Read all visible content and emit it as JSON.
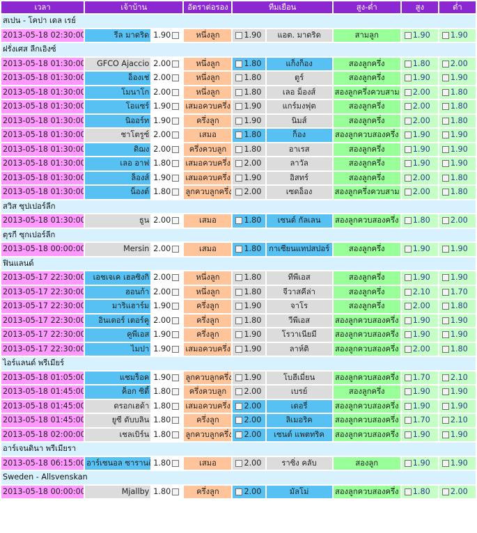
{
  "headers": [
    "เวลา",
    "เจ้าบ้าน",
    "อัตราต่อรอง",
    "ทีมเยือน",
    "สูง-ต่ำ",
    "สูง",
    "ต่ำ"
  ],
  "colors": {
    "header": "#8c28d2",
    "time": "#ff99ff",
    "favorite": "#56c1f2",
    "underdog": "#dcdcdc",
    "handicap": "#ffc499",
    "over_under": "#99ff99",
    "ou_odds": "#c5ffc5",
    "league": "#d7f1ff"
  },
  "leagues": [
    {
      "name": "สเปน - โคปา เดล เรย์",
      "matches": [
        {
          "time": "2013-05-18 02:30:00",
          "home": "รีล มาดริด",
          "home_odds": "1.90",
          "handicap": "หนึ่งลูก",
          "away_odds": "1.90",
          "away": "แอต. มาดริด",
          "ou": "สามลูก",
          "over": "1.90",
          "under": "1.90",
          "home_fav": true
        }
      ]
    },
    {
      "name": "ฝรั่งเศส ลีกเอิงซ์",
      "matches": [
        {
          "time": "2013-05-18 01:30:00",
          "home": "GFCO Ajaccio",
          "home_odds": "2.00",
          "handicap": "หนึ่งลูก",
          "away_odds": "1.80",
          "away": "แก็งก็อง",
          "ou": "สองลูกครึ่ง",
          "over": "1.80",
          "under": "2.00",
          "home_fav": false
        },
        {
          "time": "2013-05-18 01:30:00",
          "home": "อ็องเช่",
          "home_odds": "2.00",
          "handicap": "หนึ่งลูก",
          "away_odds": "1.80",
          "away": "ตูร์",
          "ou": "สองลูกครึ่ง",
          "over": "1.90",
          "under": "1.90",
          "home_fav": true
        },
        {
          "time": "2013-05-18 01:30:00",
          "home": "โมนาโก",
          "home_odds": "2.00",
          "handicap": "หนึ่งลูก",
          "away_odds": "1.80",
          "away": "เลอ ม็องส์",
          "ou": "สองลูกครึ่งควบสาม",
          "over": "2.00",
          "under": "1.80",
          "home_fav": true
        },
        {
          "time": "2013-05-18 01:30:00",
          "home": "โอแซร์",
          "home_odds": "1.90",
          "handicap": "เสมอควบครึ่ง",
          "away_odds": "1.90",
          "away": "แกร์มงฟุต",
          "ou": "สองลูกครึ่ง",
          "over": "2.00",
          "under": "1.80",
          "home_fav": true
        },
        {
          "time": "2013-05-18 01:30:00",
          "home": "นิออร์ท",
          "home_odds": "1.90",
          "handicap": "ครึ่งลูก",
          "away_odds": "1.90",
          "away": "นิมส์",
          "ou": "สองลูกครึ่ง",
          "over": "2.00",
          "under": "1.80",
          "home_fav": true
        },
        {
          "time": "2013-05-18 01:30:00",
          "home": "ชาโตรูซ์",
          "home_odds": "2.00",
          "handicap": "เสมอ",
          "away_odds": "1.80",
          "away": "ก็อง",
          "ou": "สองลูกควบสองครึ่ง",
          "over": "1.90",
          "under": "1.90",
          "home_fav": false
        },
        {
          "time": "2013-05-18 01:30:00",
          "home": "ดิฌง",
          "home_odds": "2.00",
          "handicap": "ครึ่งควบลูก",
          "away_odds": "1.80",
          "away": "อาเรส",
          "ou": "สองลูกครึ่ง",
          "over": "1.90",
          "under": "1.90",
          "home_fav": true
        },
        {
          "time": "2013-05-18 01:30:00",
          "home": "เลอ อาฟ",
          "home_odds": "1.80",
          "handicap": "เสมอควบครึ่ง",
          "away_odds": "2.00",
          "away": "ลาวัล",
          "ou": "สองลูกครึ่ง",
          "over": "1.90",
          "under": "1.90",
          "home_fav": true
        },
        {
          "time": "2013-05-18 01:30:00",
          "home": "ล็องส์",
          "home_odds": "1.90",
          "handicap": "เสมอควบครึ่ง",
          "away_odds": "1.90",
          "away": "อิสทร์",
          "ou": "สองลูกครึ่ง",
          "over": "2.00",
          "under": "1.80",
          "home_fav": true
        },
        {
          "time": "2013-05-18 01:30:00",
          "home": "น็องต์",
          "home_odds": "1.80",
          "handicap": "ลูกควบลูกครึ่ง",
          "away_odds": "2.00",
          "away": "เซดอ็อง",
          "ou": "สองลูกครึ่งควบสาม",
          "over": "2.00",
          "under": "1.80",
          "home_fav": true
        }
      ]
    },
    {
      "name": "สวิส ซุปเปอร์ลีก",
      "matches": [
        {
          "time": "2013-05-18 01:30:00",
          "home": "ธูน",
          "home_odds": "2.00",
          "handicap": "เสมอ",
          "away_odds": "1.80",
          "away": "เซนต์ กัลเลน",
          "ou": "สองลูกควบสองครึ่ง",
          "over": "1.80",
          "under": "2.00",
          "home_fav": false
        }
      ]
    },
    {
      "name": "ตุรกี ซุกเปอร์ลีก",
      "matches": [
        {
          "time": "2013-05-18 00:00:00",
          "home": "Mersin",
          "home_odds": "2.00",
          "handicap": "เสมอ",
          "away_odds": "1.80",
          "away": "กาเซียนแทปสปอร์",
          "ou": "สองลูกครึ่ง",
          "over": "1.90",
          "under": "1.90",
          "home_fav": false
        }
      ]
    },
    {
      "name": "ฟินแลนด์",
      "matches": [
        {
          "time": "2013-05-17 22:30:00",
          "home": "เอชเจเค เฮลซิงกิ",
          "home_odds": "2.00",
          "handicap": "หนึ่งลูก",
          "away_odds": "1.80",
          "away": "ทีพีเอส",
          "ou": "สองลูกครึ่ง",
          "over": "1.90",
          "under": "1.90",
          "home_fav": true
        },
        {
          "time": "2013-05-17 22:30:00",
          "home": "ฮอนก้า",
          "home_odds": "2.00",
          "handicap": "หนึ่งลูก",
          "away_odds": "1.80",
          "away": "จีวาสคีล่า",
          "ou": "สองลูกครึ่ง",
          "over": "2.10",
          "under": "1.70",
          "home_fav": true
        },
        {
          "time": "2013-05-17 22:30:00",
          "home": "มาริแฮาร์ม",
          "home_odds": "1.90",
          "handicap": "ครึ่งลูก",
          "away_odds": "1.90",
          "away": "จาโร",
          "ou": "สองลูกครึ่ง",
          "over": "2.00",
          "under": "1.80",
          "home_fav": true
        },
        {
          "time": "2013-05-17 22:30:00",
          "home": "อินเตอร์ เตอร์คู",
          "home_odds": "2.00",
          "handicap": "ครึ่งลูก",
          "away_odds": "1.80",
          "away": "วีพีเอส",
          "ou": "สองลูกควบสองครึ่ง",
          "over": "1.90",
          "under": "1.90",
          "home_fav": true
        },
        {
          "time": "2013-05-17 22:30:00",
          "home": "คูพีเอส",
          "home_odds": "1.90",
          "handicap": "ครึ่งลูก",
          "away_odds": "1.90",
          "away": "โรวาเนียมี",
          "ou": "สองลูกควบสองครึ่ง",
          "over": "1.90",
          "under": "1.90",
          "home_fav": true
        },
        {
          "time": "2013-05-17 22:30:00",
          "home": "ไมปา",
          "home_odds": "1.90",
          "handicap": "เสมอควบครึ่ง",
          "away_odds": "1.90",
          "away": "ลาห์ติ",
          "ou": "สองลูกควบสองครึ่ง",
          "over": "2.00",
          "under": "1.80",
          "home_fav": true
        }
      ]
    },
    {
      "name": "ไอร์แลนด์ พรีเมียร์",
      "matches": [
        {
          "time": "2013-05-18 01:05:00",
          "home": "แชมร็อค",
          "home_odds": "1.90",
          "handicap": "ลูกควบลูกครึ่ง",
          "away_odds": "1.90",
          "away": "โบฮีเมี่ยน",
          "ou": "สองลูกควบสองครึ่ง",
          "over": "1.70",
          "under": "2.10",
          "home_fav": true
        },
        {
          "time": "2013-05-18 01:45:00",
          "home": "ค็อก ซิตี้",
          "home_odds": "1.80",
          "handicap": "ครึ่งควบลูก",
          "away_odds": "2.00",
          "away": "เบรย์",
          "ou": "สองลูกครึ่ง",
          "over": "1.90",
          "under": "1.90",
          "home_fav": true
        },
        {
          "time": "2013-05-18 01:45:00",
          "home": "ดรอกเฮด้า",
          "home_odds": "1.80",
          "handicap": "เสมอควบครึ่ง",
          "away_odds": "2.00",
          "away": "เดอรี่",
          "ou": "สองลูกควบสองครึ่ง",
          "over": "1.90",
          "under": "1.90",
          "home_fav": false
        },
        {
          "time": "2013-05-18 01:45:00",
          "home": "ยูซี ดับบลิน",
          "home_odds": "1.80",
          "handicap": "ครึ่งลูก",
          "away_odds": "2.00",
          "away": "ลิเมอริค",
          "ou": "สองลูกควบสองครึ่ง",
          "over": "1.70",
          "under": "2.10",
          "home_fav": false
        },
        {
          "time": "2013-05-18 02:00:00",
          "home": "เชลเบิร์น",
          "home_odds": "1.80",
          "handicap": "ลูกควบลูกครึ่ง",
          "away_odds": "2.00",
          "away": "เซนต์ แพตทริค",
          "ou": "สองลูกควบสองครึ่ง",
          "over": "1.90",
          "under": "1.90",
          "home_fav": false
        }
      ]
    },
    {
      "name": "อาร์เจนตินา พรีเมียรา",
      "matches": [
        {
          "time": "2013-05-18 06:15:00",
          "home": "อาร์เซนอล ซารานดิ",
          "home_odds": "1.80",
          "handicap": "เสมอ",
          "away_odds": "2.00",
          "away": "ราซิ่ง คลับ",
          "ou": "สองลูก",
          "over": "1.90",
          "under": "1.90",
          "home_fav": true
        }
      ]
    },
    {
      "name": "Sweden - Allsvenskan",
      "matches": [
        {
          "time": "2013-05-18 00:00:00",
          "home": "Mjallby",
          "home_odds": "1.80",
          "handicap": "ครึ่งลูก",
          "away_odds": "2.00",
          "away": "มัลโม่",
          "ou": "สองลูกควบสองครึ่ง",
          "over": "1.80",
          "under": "2.00",
          "home_fav": false
        }
      ]
    }
  ]
}
